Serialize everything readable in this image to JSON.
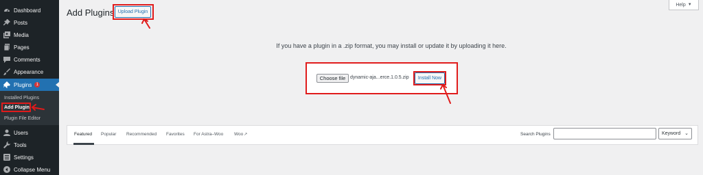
{
  "sidebar": {
    "items": [
      {
        "label": "Dashboard",
        "icon": "dashboard-icon"
      },
      {
        "label": "Posts",
        "icon": "pin-icon"
      },
      {
        "label": "Media",
        "icon": "media-icon"
      },
      {
        "label": "Pages",
        "icon": "pages-icon"
      },
      {
        "label": "Comments",
        "icon": "comment-icon"
      },
      {
        "label": "Appearance",
        "icon": "brush-icon"
      },
      {
        "label": "Plugins",
        "icon": "plugin-icon",
        "badge": "1",
        "active": true
      },
      {
        "label": "Users",
        "icon": "user-icon"
      },
      {
        "label": "Tools",
        "icon": "wrench-icon"
      },
      {
        "label": "Settings",
        "icon": "settings-icon"
      },
      {
        "label": "Collapse Menu",
        "icon": "collapse-icon"
      }
    ],
    "submenu": [
      {
        "label": "Installed Plugins"
      },
      {
        "label": "Add Plugin",
        "current": true
      },
      {
        "label": "Plugin File Editor"
      }
    ]
  },
  "header": {
    "title": "Add Plugins",
    "upload_label": "Upload Plugin",
    "help_label": "Help"
  },
  "upload": {
    "help_text": "If you have a plugin in a .zip format, you may install or update it by uploading it here.",
    "choose_label": "Choose file",
    "file_name": "dynamic-aja...erce.1.0.5.zip",
    "install_label": "Install Now"
  },
  "filter": {
    "tabs": [
      "Featured",
      "Popular",
      "Recommended",
      "Favorites",
      "For Astra–Woo",
      "Woo"
    ],
    "search_label": "Search Plugins",
    "search_value": "",
    "type_selected": "Keyword"
  },
  "colors": {
    "sidebar_bg": "#1d2327",
    "accent": "#2271b1",
    "annotation_red": "#e01b1b",
    "badge_red": "#d63638"
  }
}
